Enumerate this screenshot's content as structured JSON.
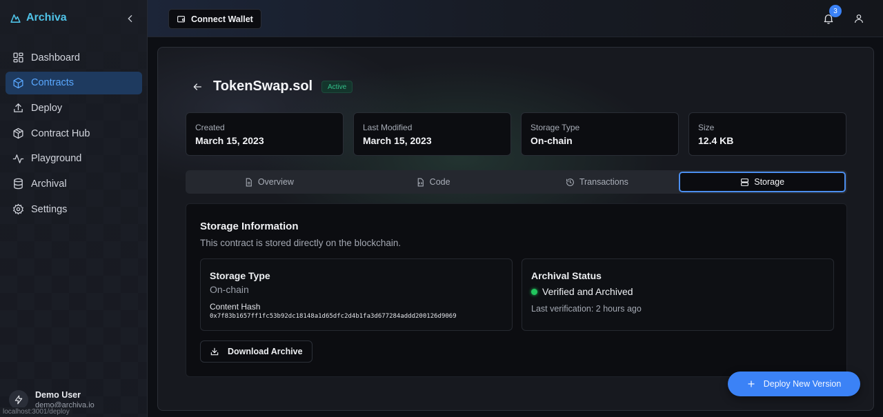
{
  "app": {
    "brand": "Archiva"
  },
  "sidebar": {
    "items": [
      {
        "label": "Dashboard",
        "icon": "dashboard-icon",
        "active": false
      },
      {
        "label": "Contracts",
        "icon": "cube-icon",
        "active": true
      },
      {
        "label": "Deploy",
        "icon": "upload-icon",
        "active": false
      },
      {
        "label": "Contract Hub",
        "icon": "package-icon",
        "active": false
      },
      {
        "label": "Playground",
        "icon": "activity-icon",
        "active": false
      },
      {
        "label": "Archival",
        "icon": "database-icon",
        "active": false
      },
      {
        "label": "Settings",
        "icon": "gear-icon",
        "active": false
      }
    ],
    "user": {
      "name": "Demo User",
      "email": "demo@archiva.io"
    }
  },
  "status_bar": {
    "url": "localhost:3001/deploy"
  },
  "topbar": {
    "wallet_label": "Connect Wallet",
    "notification_count": "3"
  },
  "contract": {
    "name": "TokenSwap.sol",
    "status": "Active",
    "stats": [
      {
        "label": "Created",
        "value": "March 15, 2023"
      },
      {
        "label": "Last Modified",
        "value": "March 15, 2023"
      },
      {
        "label": "Storage Type",
        "value": "On-chain"
      },
      {
        "label": "Size",
        "value": "12.4 KB"
      }
    ]
  },
  "tabs": [
    {
      "label": "Overview",
      "icon": "document-icon",
      "active": false
    },
    {
      "label": "Code",
      "icon": "code-file-icon",
      "active": false
    },
    {
      "label": "Transactions",
      "icon": "history-icon",
      "active": false
    },
    {
      "label": "Storage",
      "icon": "server-icon",
      "active": true
    }
  ],
  "storage": {
    "title": "Storage Information",
    "subtitle": "This contract is stored directly on the blockchain.",
    "type_heading": "Storage Type",
    "type_value": "On-chain",
    "hash_label": "Content Hash",
    "hash_value": "0x7f83b1657ff1fc53b92dc18148a1d65dfc2d4b1fa3d677284addd200126d9069",
    "archival_heading": "Archival Status",
    "archival_status": "Verified and Archived",
    "last_verification": "Last verification: 2 hours ago",
    "download_label": "Download Archive"
  },
  "deploy_button": {
    "label": "Deploy New Version"
  },
  "colors": {
    "accent": "#3b82f6",
    "brand": "#4fc3e8",
    "success": "#22c55e",
    "active_nav_bg": "#1e3a5f"
  }
}
